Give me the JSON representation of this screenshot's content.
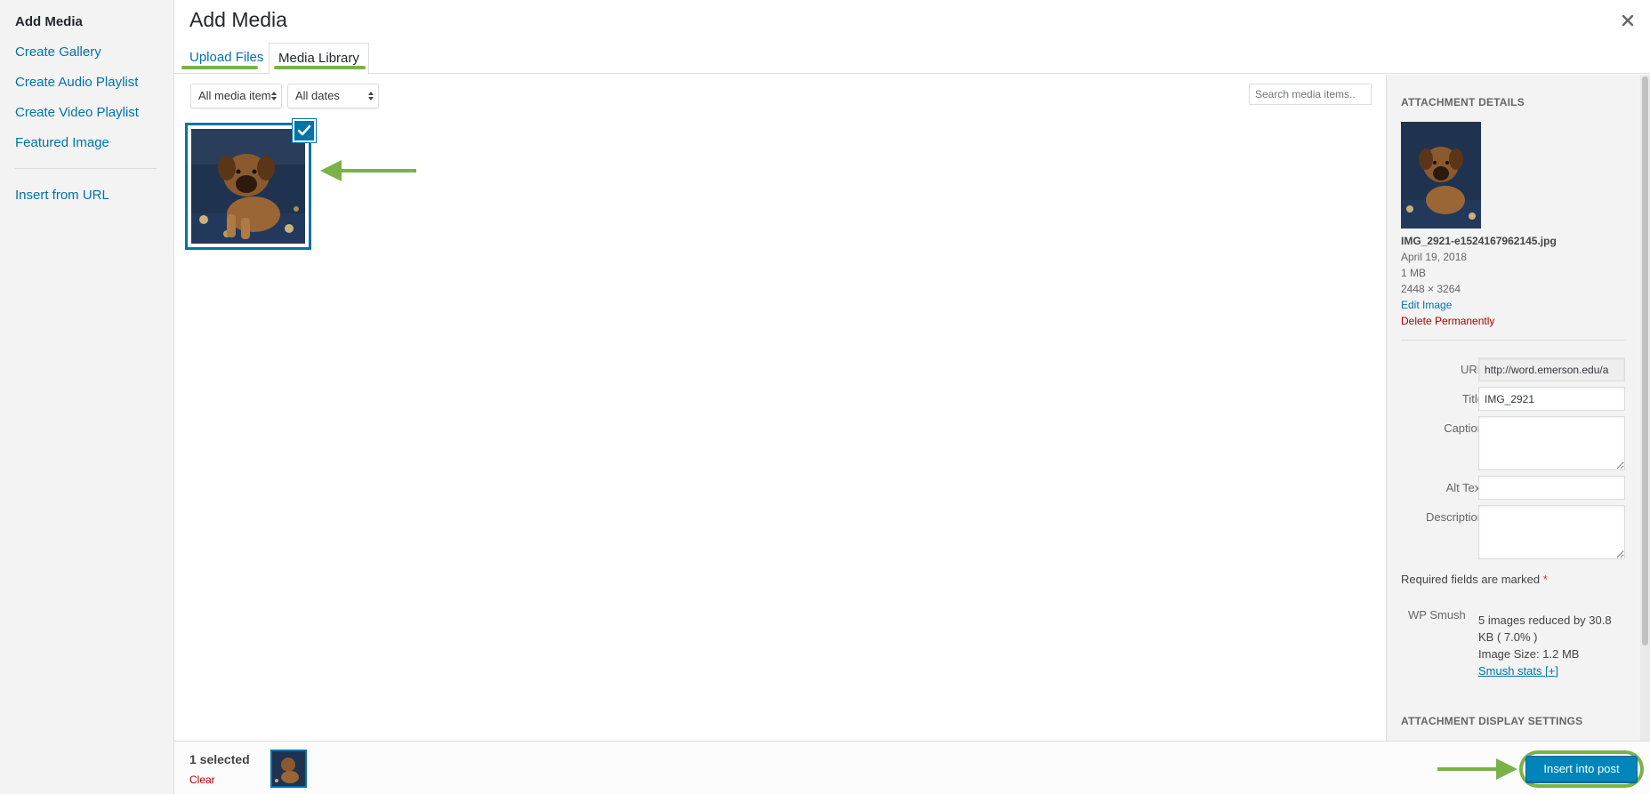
{
  "left_menu": {
    "title": "Add Media",
    "items": [
      {
        "label": "Create Gallery"
      },
      {
        "label": "Create Audio Playlist"
      },
      {
        "label": "Create Video Playlist"
      },
      {
        "label": "Featured Image"
      },
      {
        "label": "Insert from URL"
      }
    ]
  },
  "header": {
    "title": "Add Media",
    "close_icon": "close-icon",
    "tabs": [
      {
        "label": "Upload Files",
        "active": false
      },
      {
        "label": "Media Library",
        "active": true
      }
    ]
  },
  "toolbar": {
    "filter_type": "All media item",
    "filter_date": "All dates",
    "search_placeholder": "Search media items..."
  },
  "attachments": [
    {
      "name": "IMG_2921-e1524167962145.jpg",
      "selected": true
    }
  ],
  "sidebar": {
    "details_heading": "Attachment Details",
    "filename": "IMG_2921-e1524167962145.jpg",
    "date": "April 19, 2018",
    "filesize": "1 MB",
    "dimensions": "2448 × 3264",
    "edit_link": "Edit Image",
    "delete_link": "Delete Permanently",
    "fields": {
      "url_label": "URL",
      "url_value": "http://word.emerson.edu/a",
      "title_label": "Title",
      "title_value": "IMG_2921",
      "caption_label": "Caption",
      "caption_value": "",
      "alt_label": "Alt Text",
      "alt_value": "",
      "description_label": "Description",
      "description_value": ""
    },
    "required_note": "Required fields are marked",
    "required_mark": "*",
    "smush": {
      "label": "WP Smush",
      "line1": "5 images reduced by 30.8",
      "line2": "KB ( 7.0% )",
      "line3": "Image Size: 1.2 MB",
      "link": "Smush stats [+]"
    },
    "display_heading": "Attachment Display Settings"
  },
  "footer": {
    "selected_count": "1 selected",
    "clear_label": "Clear",
    "insert_label": "Insert into post"
  },
  "colors": {
    "accent": "#0073aa",
    "primary_button": "#0085ba",
    "annotation_green": "#7ab24a",
    "delete_red": "#a00"
  }
}
